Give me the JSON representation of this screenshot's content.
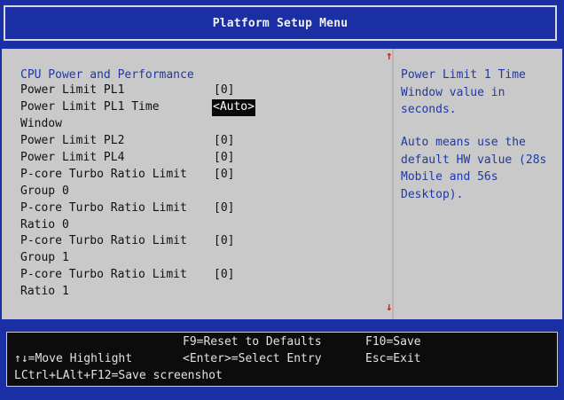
{
  "header": {
    "title": "Platform Setup Menu"
  },
  "section": {
    "title": "CPU Power and Performance"
  },
  "settings": [
    {
      "label": "Power Limit PL1",
      "value": "[0]"
    },
    {
      "label": "Power Limit PL1 Time Window",
      "value": "<Auto>",
      "selected": true
    },
    {
      "label": "Power Limit PL2",
      "value": "[0]"
    },
    {
      "label": "Power Limit PL4",
      "value": "[0]"
    },
    {
      "label": "P-core Turbo Ratio Limit Group 0",
      "value": "[0]"
    },
    {
      "label": "P-core Turbo Ratio Limit Ratio 0",
      "value": "[0]"
    },
    {
      "label": "P-core Turbo Ratio Limit Group 1",
      "value": "[0]"
    },
    {
      "label": "P-core Turbo Ratio Limit Ratio 1",
      "value": "[0]"
    }
  ],
  "help": {
    "paragraph1": "Power Limit 1 Time Window value in seconds.",
    "paragraph2": "Auto means use the default HW value (28s Mobile and 56s Desktop)."
  },
  "scroll": {
    "up": "↑",
    "down": "↓"
  },
  "footer": {
    "reset": "F9=Reset to Defaults",
    "save": "F10=Save",
    "move": "↑↓=Move Highlight",
    "select": "<Enter>=Select Entry",
    "exit": "Esc=Exit",
    "screenshot": "LCtrl+LAlt+F12=Save screenshot"
  },
  "colors": {
    "frame": "#1a2fa3",
    "panel": "#c9c9c9",
    "accent_text": "#1e38a8",
    "scroll_arrow": "#d42020"
  }
}
